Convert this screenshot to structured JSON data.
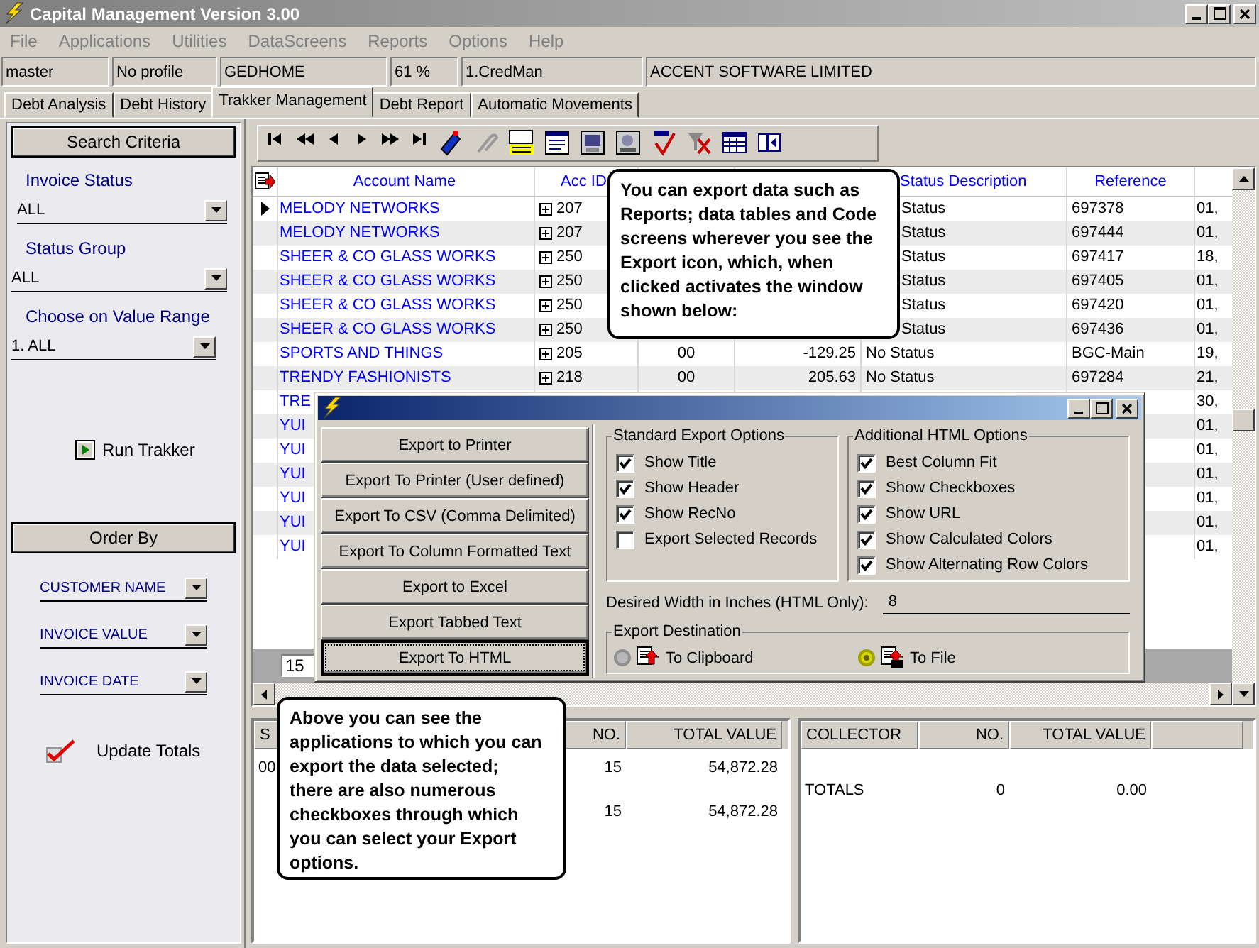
{
  "window": {
    "title": "Capital Management Version 3.00"
  },
  "menu": [
    "File",
    "Applications",
    "Utilities",
    "DataScreens",
    "Reports",
    "Options",
    "Help"
  ],
  "status_fields": [
    "master",
    "No profile",
    "GEDHOME",
    "61 %",
    "1.CredMan",
    "ACCENT SOFTWARE LIMITED"
  ],
  "tabs": [
    {
      "label": "Debt Analysis",
      "selected": false
    },
    {
      "label": "Debt History",
      "selected": false
    },
    {
      "label": "Trakker Management",
      "selected": true
    },
    {
      "label": "Debt Report",
      "selected": false
    },
    {
      "label": "Automatic Movements",
      "selected": false
    }
  ],
  "search_panel": {
    "title": "Search Criteria",
    "filters": [
      {
        "label": "Invoice Status",
        "value": "ALL"
      },
      {
        "label": "Status Group",
        "value": "ALL"
      },
      {
        "label": "Choose on Value Range",
        "value": "1. ALL"
      }
    ],
    "run_button": "Run Trakker",
    "order_title": "Order By",
    "order_fields": [
      "CUSTOMER NAME",
      "INVOICE VALUE",
      "INVOICE DATE"
    ],
    "update_totals": {
      "label": "Update Totals",
      "checked": true
    }
  },
  "grid": {
    "columns": [
      {
        "label": "Account Name"
      },
      {
        "label": "Acc ID"
      },
      {},
      {},
      {
        "label": "Status Description"
      },
      {
        "label": "Reference"
      },
      {}
    ],
    "rows": [
      {
        "selected": true,
        "account": "MELODY NETWORKS",
        "acc_id": "207",
        "status": "Status",
        "reference": "697378",
        "column_8": "01,"
      },
      {
        "selected": false,
        "account": "MELODY NETWORKS",
        "acc_id": "207",
        "status": "Status",
        "reference": "697444",
        "column_8": "01,"
      },
      {
        "selected": false,
        "account": "SHEER & CO GLASS WORKS",
        "acc_id": "250",
        "status": "Status",
        "reference": "697417",
        "column_8": "18,"
      },
      {
        "selected": false,
        "account": "SHEER & CO GLASS WORKS",
        "acc_id": "250",
        "status": "Status",
        "reference": "697405",
        "column_8": "01,"
      },
      {
        "selected": false,
        "account": "SHEER & CO GLASS WORKS",
        "acc_id": "250",
        "status": "Status",
        "reference": "697420",
        "column_8": "01,"
      },
      {
        "selected": false,
        "account": "SHEER & CO GLASS WORKS",
        "acc_id": "250",
        "status": "Status",
        "reference": "697436",
        "column_8": "01,"
      },
      {
        "selected": false,
        "account": "SPORTS AND THINGS",
        "acc_id": "205",
        "column_3": "00",
        "column_4": "-129.25",
        "status": "No Status",
        "reference": "BGC-Main",
        "column_8": "19,"
      },
      {
        "selected": false,
        "account": "TRENDY FASHIONISTS",
        "acc_id": "218",
        "column_3": "00",
        "column_4": "205.63",
        "status": "No Status",
        "reference": "697284",
        "column_8": "21,"
      },
      {
        "selected": false,
        "account": "TRE",
        "column_8": "30,"
      },
      {
        "selected": false,
        "account": "YUI",
        "column_8": "01,"
      },
      {
        "selected": false,
        "account": "YUI",
        "column_8": "01,"
      },
      {
        "selected": false,
        "account": "YUI",
        "column_8": "01,"
      },
      {
        "selected": false,
        "account": "YUI",
        "column_8": "01,"
      },
      {
        "selected": false,
        "account": "YUI",
        "column_8": "01,"
      },
      {
        "selected": false,
        "account": "YUI",
        "column_8": "01,"
      }
    ],
    "record_count": "15"
  },
  "summary_left": {
    "columns": [
      "S",
      "NO.",
      "TOTAL VALUE"
    ],
    "rows": [
      {
        "column_1": "00",
        "no": "15",
        "total_value": "54,872.28"
      },
      {
        "no": "15",
        "total_value": "54,872.28"
      }
    ]
  },
  "summary_right": {
    "columns": [
      "COLLECTOR",
      "NO.",
      "TOTAL VALUE"
    ],
    "rows": [
      {
        "collector": "TOTALS",
        "no": "0",
        "total_value": "0.00"
      }
    ]
  },
  "callouts": [
    "You can export data such as Reports; data tables and Code screens wherever you see the Export icon, which, when clicked activates the window shown below:",
    "Above you can see the applications to which you can export the data selected; there are also numerous checkboxes through which you can select your Export options."
  ],
  "dialog": {
    "buttons": [
      {
        "label": "Export to Printer",
        "focused": false
      },
      {
        "label": "Export To Printer (User defined)",
        "focused": false
      },
      {
        "label": "Export To CSV (Comma Delimited)",
        "focused": false
      },
      {
        "label": "Export To Column Formatted Text",
        "focused": false
      },
      {
        "label": "Export to Excel",
        "focused": false
      },
      {
        "label": "Export Tabbed Text",
        "focused": false
      },
      {
        "label": "Export To HTML",
        "focused": true
      }
    ],
    "standard_options": {
      "title": "Standard Export Options",
      "items": [
        {
          "label": "Show Title",
          "checked": true
        },
        {
          "label": "Show Header",
          "checked": true
        },
        {
          "label": "Show RecNo",
          "checked": true
        },
        {
          "label": "Export Selected Records",
          "checked": false
        }
      ]
    },
    "html_options": {
      "title": "Additional HTML Options",
      "items": [
        {
          "label": "Best Column Fit",
          "checked": true
        },
        {
          "label": "Show Checkboxes",
          "checked": true
        },
        {
          "label": "Show URL",
          "checked": true
        },
        {
          "label": "Show Calculated Colors",
          "checked": true
        },
        {
          "label": "Show Alternating Row Colors",
          "checked": true
        }
      ]
    },
    "width_label": "Desired Width in Inches (HTML Only):",
    "width_value": "8",
    "destination": {
      "title": "Export Destination",
      "options": [
        {
          "label": "To Clipboard",
          "selected": false
        },
        {
          "label": "To File",
          "selected": true
        }
      ]
    }
  }
}
